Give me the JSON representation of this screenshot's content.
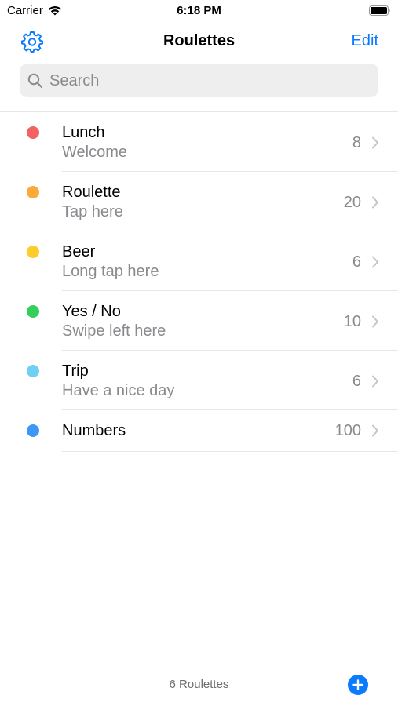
{
  "status_bar": {
    "carrier": "Carrier",
    "time": "6:18 PM"
  },
  "nav": {
    "title": "Roulettes",
    "edit_label": "Edit"
  },
  "search": {
    "placeholder": "Search",
    "value": ""
  },
  "roulettes": [
    {
      "title": "Lunch",
      "subtitle": "Welcome",
      "count": "8",
      "color": "#f06360"
    },
    {
      "title": "Roulette",
      "subtitle": "Tap here",
      "count": "20",
      "color": "#fbaa3b"
    },
    {
      "title": "Beer",
      "subtitle": "Long tap here",
      "count": "6",
      "color": "#fccd2a"
    },
    {
      "title": "Yes / No",
      "subtitle": "Swipe left here",
      "count": "10",
      "color": "#34cf5b"
    },
    {
      "title": "Trip",
      "subtitle": "Have a nice day",
      "count": "6",
      "color": "#70d0f3"
    },
    {
      "title": "Numbers",
      "subtitle": "",
      "count": "100",
      "color": "#3c97f7"
    }
  ],
  "footer": {
    "count_label": "6 Roulettes"
  },
  "colors": {
    "accent": "#0a7aff",
    "secondary_text": "#8a8a8e"
  },
  "icons": [
    "wifi-icon",
    "battery-icon",
    "gear-icon",
    "search-icon",
    "chevron-right-icon",
    "plus-icon"
  ]
}
